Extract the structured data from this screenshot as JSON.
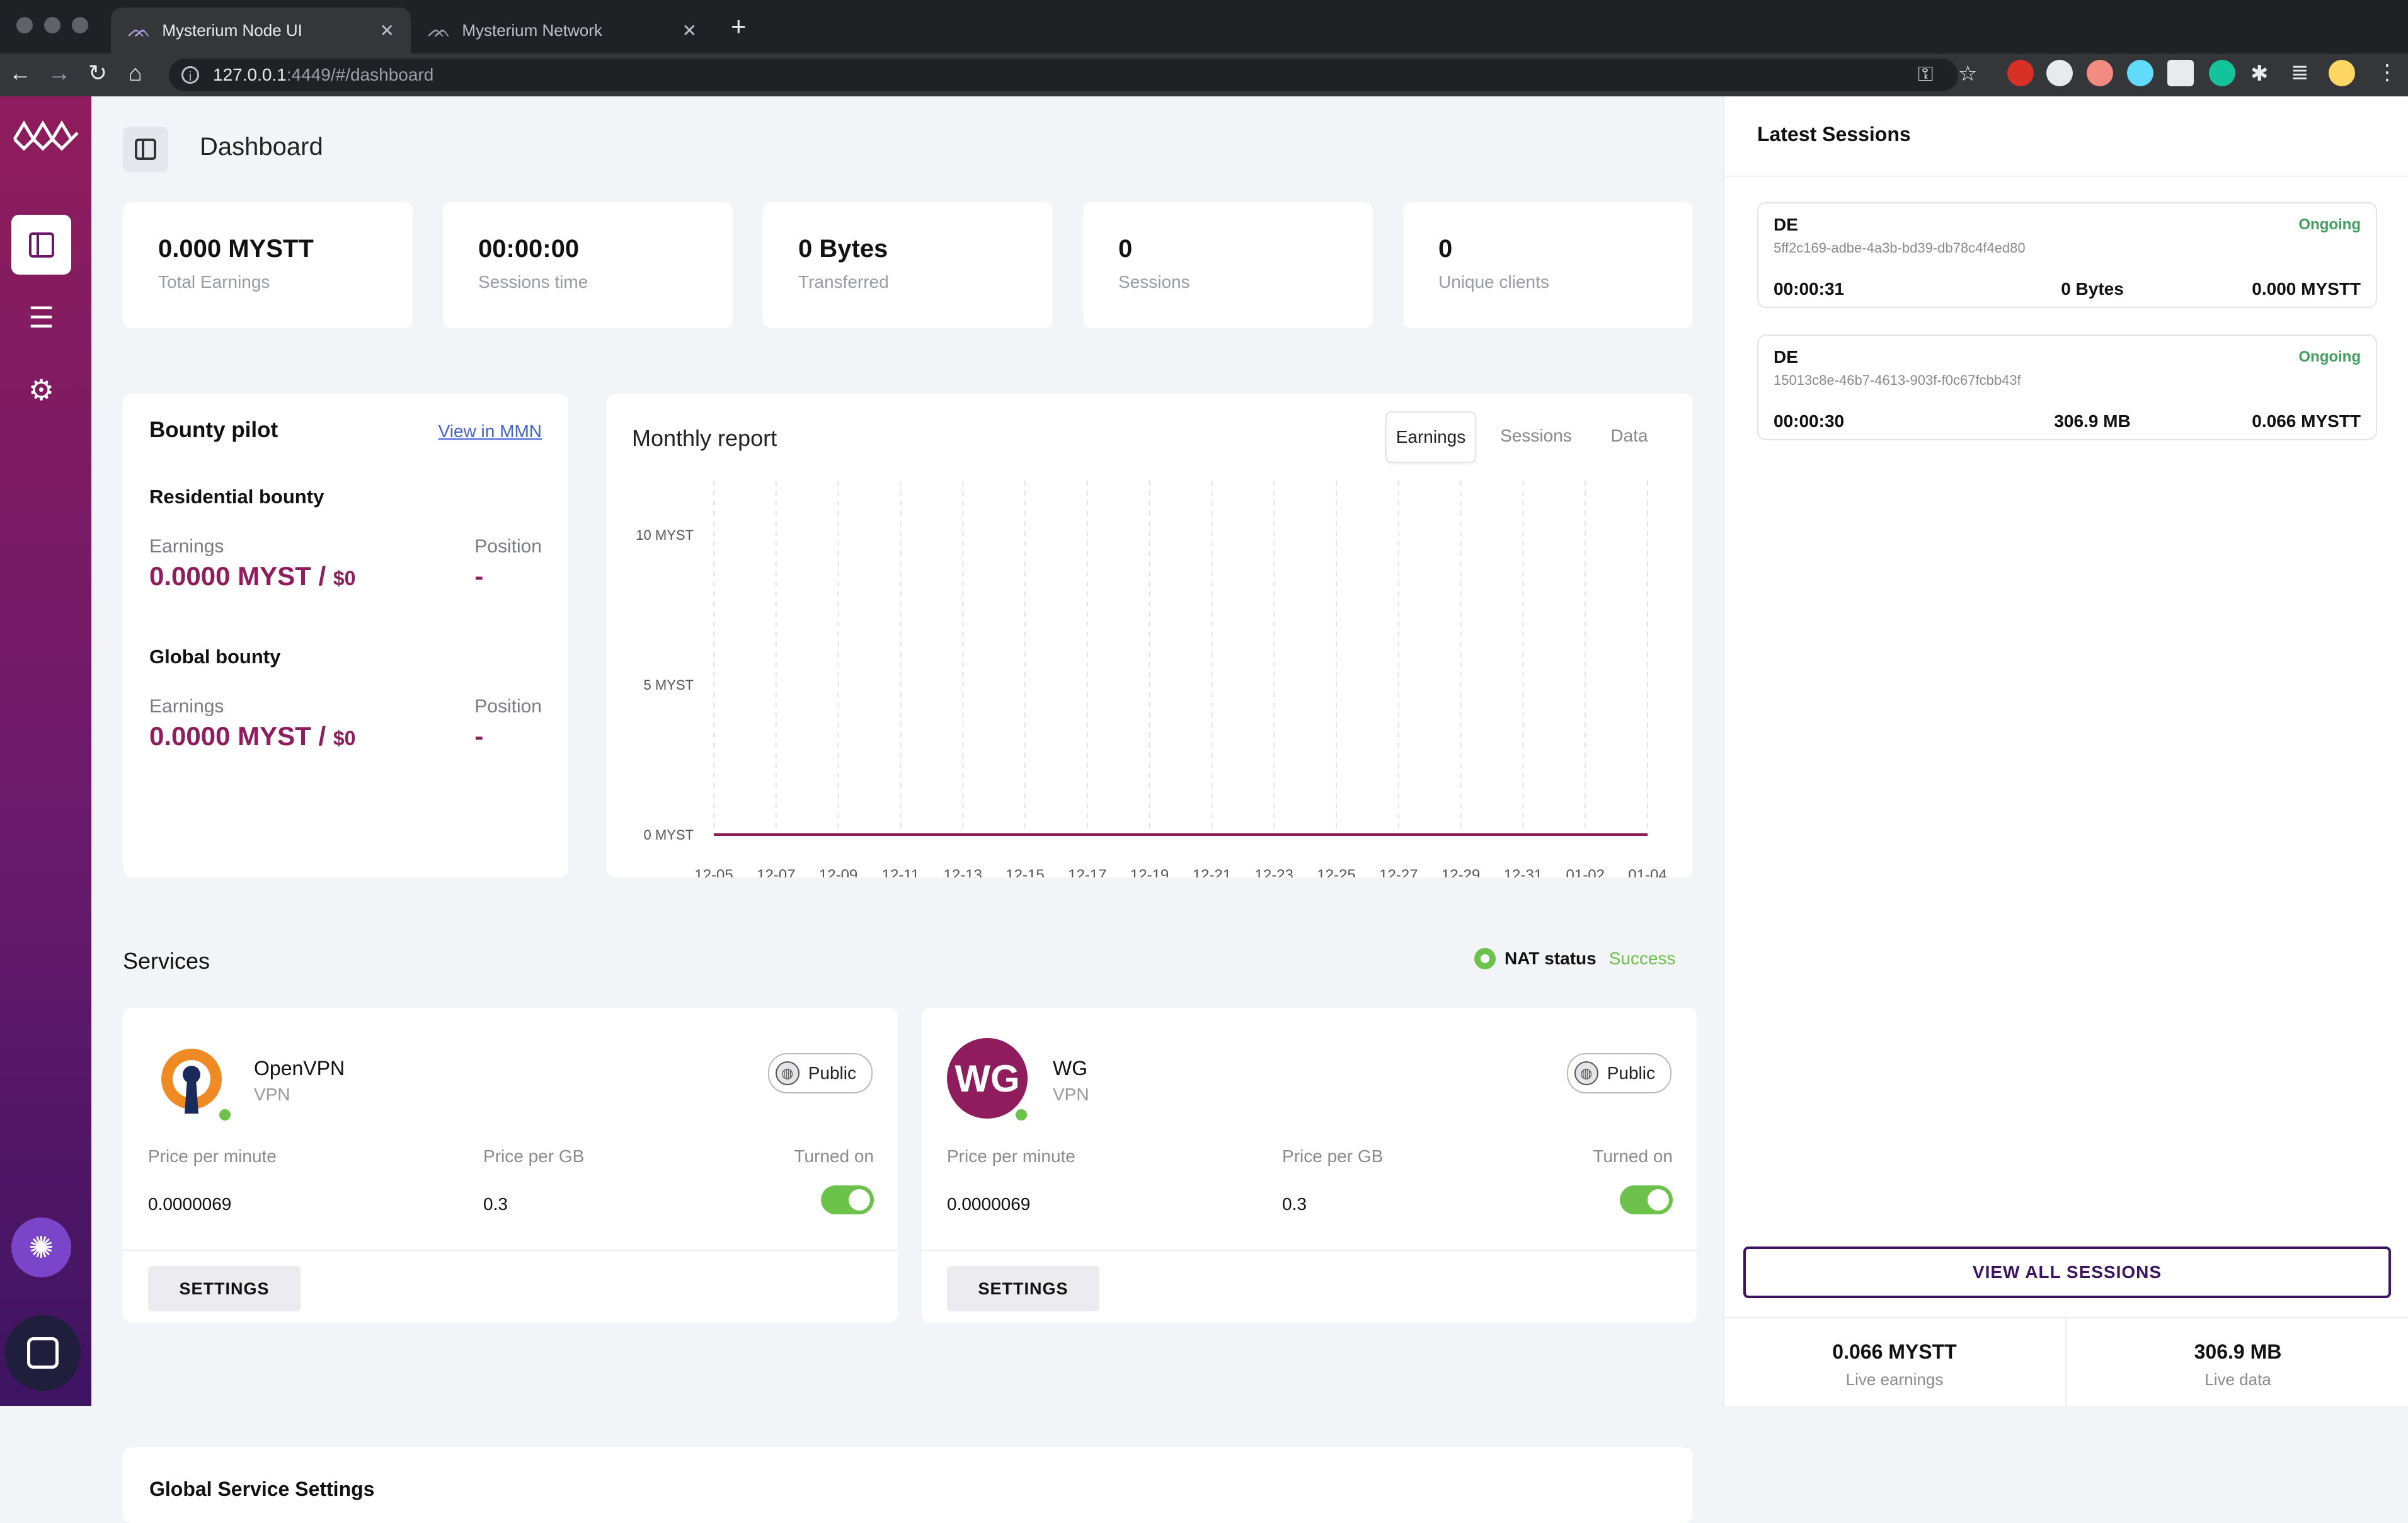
{
  "browser": {
    "tabs": [
      {
        "title": "Mysterium Node UI",
        "active": true
      },
      {
        "title": "Mysterium Network",
        "active": false
      }
    ],
    "url_host": "127.0.0.1",
    "url_rest": ":4449/#/dashboard"
  },
  "header": {
    "title": "Dashboard"
  },
  "stats": [
    {
      "value": "0.000 MYSTT",
      "label": "Total Earnings"
    },
    {
      "value": "00:00:00",
      "label": "Sessions time"
    },
    {
      "value": "0 Bytes",
      "label": "Transferred"
    },
    {
      "value": "0",
      "label": "Sessions"
    },
    {
      "value": "0",
      "label": "Unique clients"
    }
  ],
  "bounty": {
    "title": "Bounty pilot",
    "link": "View in MMN",
    "residential": {
      "title": "Residential bounty",
      "earnings_label": "Earnings",
      "earnings_value": "0.0000 MYST / ",
      "earnings_usd": "$0",
      "position_label": "Position",
      "position_value": "-"
    },
    "global": {
      "title": "Global bounty",
      "earnings_label": "Earnings",
      "earnings_value": "0.0000 MYST / ",
      "earnings_usd": "$0",
      "position_label": "Position",
      "position_value": "-"
    }
  },
  "report": {
    "title": "Monthly report",
    "tabs": [
      "Earnings",
      "Sessions",
      "Data"
    ],
    "active_tab": "Earnings"
  },
  "chart_data": {
    "type": "line",
    "title": "",
    "x": [
      "12-05",
      "12-07",
      "12-09",
      "12-11",
      "12-13",
      "12-15",
      "12-17",
      "12-19",
      "12-21",
      "12-23",
      "12-25",
      "12-27",
      "12-29",
      "12-31",
      "01-02",
      "01-04"
    ],
    "series": [
      {
        "values": [
          0,
          0,
          0,
          0,
          0,
          0,
          0,
          0,
          0,
          0,
          0,
          0,
          0,
          0,
          0,
          0
        ]
      }
    ],
    "yticks": [
      "0 MYST",
      "5 MYST",
      "10 MYST"
    ],
    "ylim": [
      0,
      10
    ],
    "grid": "vertical dashed",
    "color": "#8f1c5c"
  },
  "services": {
    "title": "Services",
    "nat_label": "NAT status",
    "nat_value": "Success",
    "items": [
      {
        "name": "OpenVPN",
        "type": "VPN",
        "visibility": "Public",
        "price_minute_label": "Price per minute",
        "price_minute": "0.0000069",
        "price_gb_label": "Price per GB",
        "price_gb": "0.3",
        "turned_on_label": "Turned on",
        "turned_on": true,
        "settings_label": "SETTINGS"
      },
      {
        "name": "WG",
        "type": "VPN",
        "visibility": "Public",
        "logo_text": "WG",
        "price_minute_label": "Price per minute",
        "price_minute": "0.0000069",
        "price_gb_label": "Price per GB",
        "price_gb": "0.3",
        "turned_on_label": "Turned on",
        "turned_on": true,
        "settings_label": "SETTINGS"
      }
    ]
  },
  "global_settings": {
    "title": "Global Service Settings"
  },
  "latest_sessions": {
    "title": "Latest Sessions",
    "items": [
      {
        "country": "DE",
        "status": "Ongoing",
        "id": "5ff2c169-adbe-4a3b-bd39-db78c4f4ed80",
        "duration": "00:00:31",
        "data": "0 Bytes",
        "earnings": "0.000 MYSTT"
      },
      {
        "country": "DE",
        "status": "Ongoing",
        "id": "15013c8e-46b7-4613-903f-f0c67fcbb43f",
        "duration": "00:00:30",
        "data": "306.9 MB",
        "earnings": "0.066 MYSTT"
      }
    ],
    "view_all": "VIEW ALL SESSIONS",
    "live_earnings_value": "0.066 MYSTT",
    "live_earnings_label": "Live earnings",
    "live_data_value": "306.9 MB",
    "live_data_label": "Live data"
  }
}
